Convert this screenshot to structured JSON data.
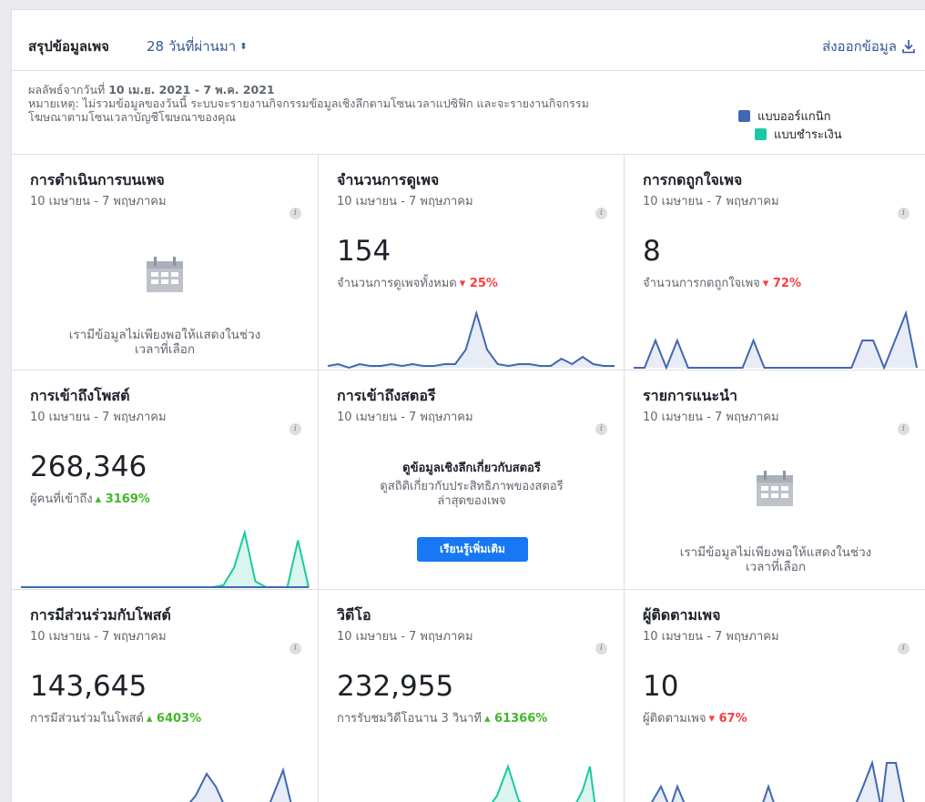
{
  "header": {
    "title": "สรุปข้อมูลเพจ",
    "range_label": "28 วันที่ผ่านมา",
    "range_arrow": "⬍",
    "export_label": "ส่งออกข้อมูล",
    "export_icon": "download-icon"
  },
  "info": {
    "range_prefix": "ผลลัพธ์จากวันที่",
    "range_value": "10 เม.ย. 2021 - 7 พ.ค. 2021",
    "note_line1": "หมายเหตุ: ไม่รวมข้อมูลของวันนี้ ระบบจะรายงานกิจกรรมข้อมูลเชิงลึกตามโซนเวลาแปซิฟิก และจะรายงานกิจกรรม",
    "note_line2": "โฆษณาตามโซนเวลาบัญชีโฆษณาของคุณ"
  },
  "legend": {
    "organic": {
      "label": "แบบออร์แกนิก",
      "color": "#4267b2"
    },
    "paid": {
      "label": "แบบชำระเงิน",
      "color": "#1cc9a3"
    }
  },
  "colors": {
    "organic_line": "#4267b2",
    "organic_fill": "#e8ecf6",
    "paid_line": "#1cc9a3",
    "paid_fill": "#d9f5ee",
    "up": "#42b72a",
    "down": "#fa3e3e"
  },
  "info_icon": "info-icon",
  "date_range": "10 เมษายน - 7 พฤษภาคม",
  "empty_message_1": "เรามีข้อมูลไม่เพียงพอให้แสดงในช่วง",
  "empty_message_2": "เวลาที่เลือก",
  "cards": {
    "page_actions": {
      "title": "การดำเนินการบนเพจ",
      "icon": "calendar-icon"
    },
    "page_views": {
      "title": "จำนวนการดูเพจ",
      "value": "154",
      "sub": "จำนวนการดูเพจทั้งหมด",
      "delta": "25%",
      "direction": "down",
      "trend": {
        "organic": [
          1,
          2,
          0,
          2,
          1,
          1,
          2,
          1,
          2,
          1,
          1,
          2,
          2,
          10,
          30,
          10,
          2,
          1,
          2,
          2,
          1,
          1,
          5,
          2,
          6,
          2,
          1,
          1
        ]
      }
    },
    "page_likes": {
      "title": "การกดถูกใจเพจ",
      "value": "8",
      "sub": "จำนวนการกดถูกใจเพจ",
      "delta": "72%",
      "direction": "down",
      "trend": {
        "organic": [
          0,
          0,
          1,
          0,
          1,
          0,
          0,
          0,
          0,
          0,
          0,
          1,
          0,
          0,
          0,
          0,
          0,
          0,
          0,
          0,
          0,
          1,
          1,
          0,
          1,
          2,
          0
        ]
      }
    },
    "post_reach": {
      "title": "การเข้าถึงโพสต์",
      "value": "268,346",
      "sub": "ผู้คนที่เข้าถึง",
      "delta": "3169%",
      "direction": "up",
      "trend": {
        "organic": [
          0,
          0,
          0,
          0,
          0,
          0,
          0,
          0,
          0,
          0,
          0,
          0,
          0,
          0,
          0,
          0,
          0,
          0,
          0,
          0,
          0,
          0,
          0,
          0,
          0,
          0,
          0,
          0
        ],
        "paid": [
          0,
          0,
          0,
          0,
          0,
          0,
          0,
          0,
          0,
          0,
          0,
          0,
          0,
          0,
          0,
          0,
          0,
          0,
          0,
          1,
          10,
          28,
          3,
          0,
          0,
          0,
          24,
          0
        ]
      }
    },
    "story_reach": {
      "title": "การเข้าถึงสตอรี",
      "promo_heading": "ดูข้อมูลเชิงลึกเกี่ยวกับสตอรี",
      "promo_line1": "ดูสถิติเกี่ยวกับประสิทธิภาพของสตอรี",
      "promo_line2": "ล่าสุดของเพจ",
      "button_label": "เรียนรู้เพิ่มเติม"
    },
    "recommendations": {
      "title": "รายการแนะนำ",
      "icon": "calendar-icon"
    },
    "post_engagement": {
      "title": "การมีส่วนร่วมกับโพสต์",
      "value": "143,645",
      "sub": "การมีส่วนร่วมในโพสต์",
      "delta": "6403%",
      "direction": "up"
    },
    "videos": {
      "title": "วิดีโอ",
      "value": "232,955",
      "sub": "การรับชมวิดีโอนาน 3 วินาที",
      "delta": "61366%",
      "direction": "up"
    },
    "page_followers": {
      "title": "ผู้ติดตามเพจ",
      "value": "10",
      "sub": "ผู้ติดตามเพจ",
      "delta": "67%",
      "direction": "down"
    }
  }
}
